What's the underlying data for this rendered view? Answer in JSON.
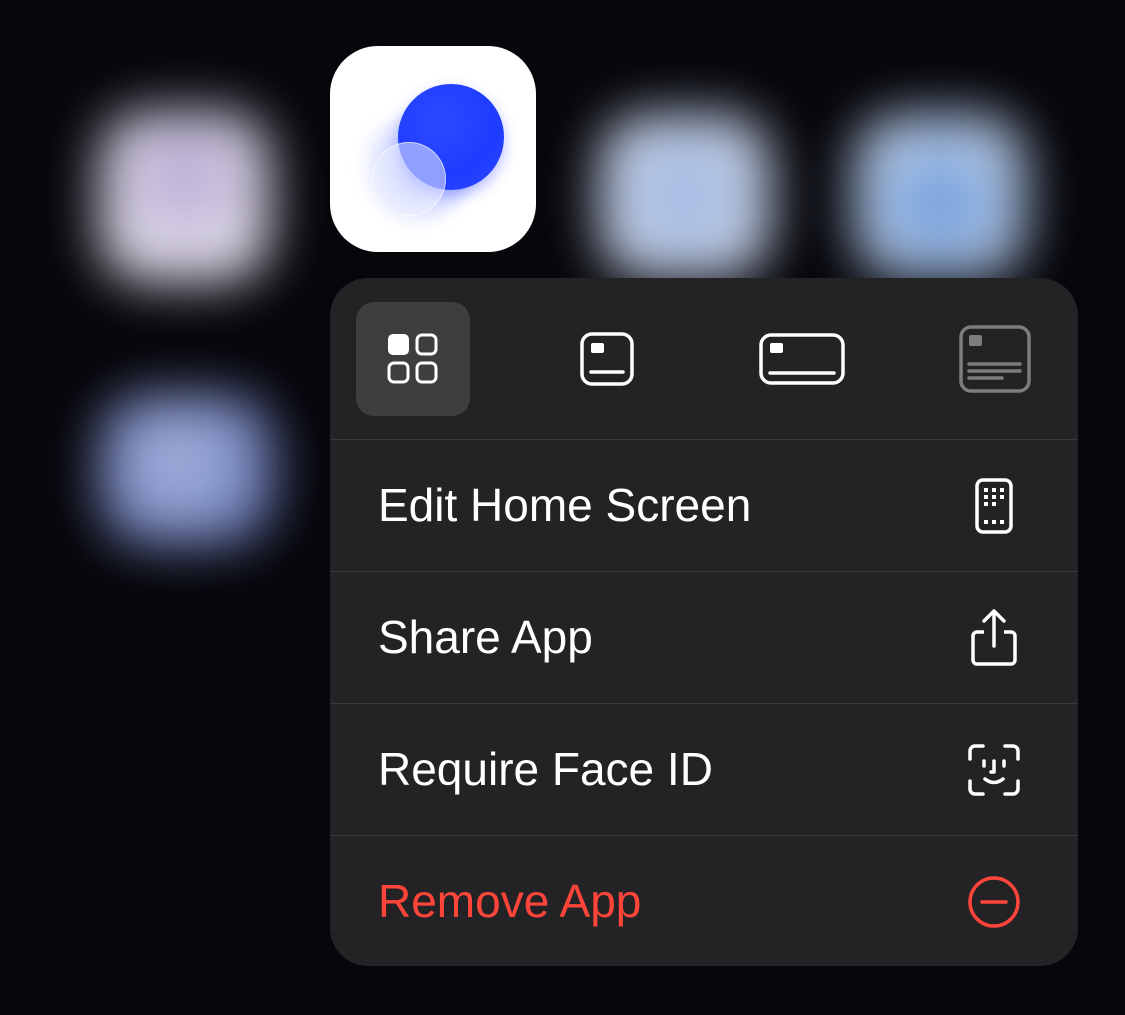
{
  "app": {
    "name": "",
    "icon": "blue-orb-app-icon"
  },
  "background_icons": [
    {
      "icon": "blurred-app-icon",
      "tint": "#d8d2e6"
    },
    {
      "icon": "blurred-app-icon",
      "tint": "#c2d0ea"
    },
    {
      "icon": "blurred-app-icon",
      "tint": "#a8c2e6"
    },
    {
      "icon": "blurred-app-icon",
      "tint": "#7f90c8"
    }
  ],
  "widget_sizes": [
    {
      "icon": "small-icon-size-icon",
      "selected": true
    },
    {
      "icon": "small-widget-size-icon",
      "selected": false
    },
    {
      "icon": "medium-widget-size-icon",
      "selected": false
    },
    {
      "icon": "large-widget-size-icon",
      "selected": false,
      "disabled": true
    }
  ],
  "menu": {
    "items": [
      {
        "label": "Edit Home Screen",
        "icon": "home-screen-edit-icon",
        "destructive": false
      },
      {
        "label": "Share App",
        "icon": "share-icon",
        "destructive": false
      },
      {
        "label": "Require Face ID",
        "icon": "face-id-icon",
        "destructive": false
      },
      {
        "label": "Remove App",
        "icon": "minus-circle-icon",
        "destructive": true
      }
    ]
  },
  "colors": {
    "background": "#06060b",
    "menu_background": "#232325",
    "separator": "#3a3a3d",
    "selected_size_background": "#3e3e41",
    "text": "#ffffff",
    "destructive": "#ff453a",
    "app_accent": "#1f3cff"
  }
}
